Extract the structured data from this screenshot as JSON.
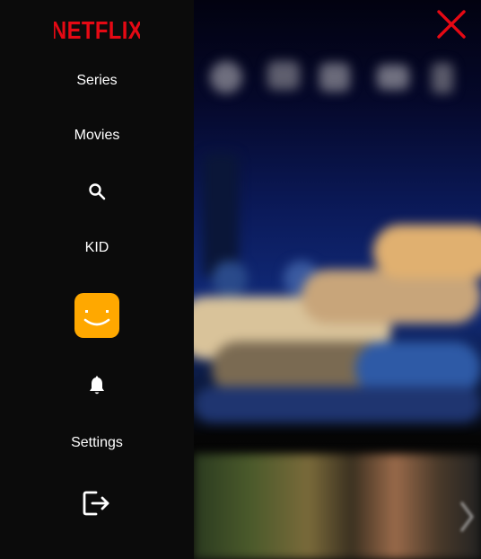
{
  "brand": {
    "name": "NETFLIX",
    "color": "#e50914"
  },
  "sidebar": {
    "items": [
      {
        "label": "Series"
      },
      {
        "label": "Movies"
      },
      {
        "icon": "search-icon"
      },
      {
        "label": "KID"
      },
      {
        "icon": "profile-avatar",
        "color": "#ffa800"
      },
      {
        "icon": "bell-icon"
      },
      {
        "label": "Settings"
      },
      {
        "icon": "logout-icon"
      }
    ]
  },
  "close": {
    "icon": "close-icon",
    "color": "#e50914"
  }
}
